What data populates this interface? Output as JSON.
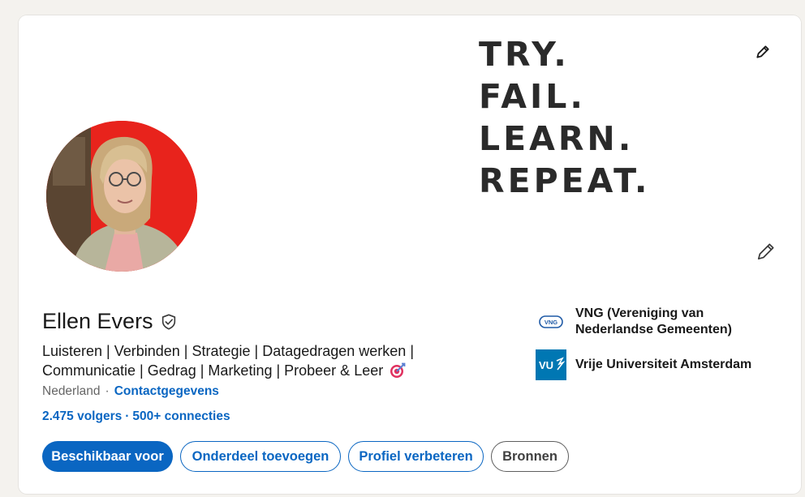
{
  "banner": {
    "lines": [
      "TRY.",
      "FAIL.",
      "LEARN.",
      "REPEAT."
    ]
  },
  "profile": {
    "name": "Ellen Evers",
    "headline_line1": "Luisteren | Verbinden | Strategie | Datagedragen werken |",
    "headline_line2": "Communicatie | Gedrag | Marketing | Probeer & Leer",
    "location": "Nederland",
    "location_separator": "·",
    "contact_label": "Contactgegevens",
    "followers": "2.475 volgers",
    "stats_separator": "·",
    "connections": "500+ connecties"
  },
  "actions": {
    "available": "Beschikbaar voor",
    "add_section": "Onderdeel toevoegen",
    "improve_profile": "Profiel verbeteren",
    "resources": "Bronnen"
  },
  "organizations": [
    {
      "name_line1": "VNG (Vereniging van",
      "name_line2": "Nederlandse Gemeenten)",
      "logo_text": "VNG"
    },
    {
      "name_line1": "Vrije Universiteit Amsterdam",
      "name_line2": "",
      "logo_text": "VU"
    }
  ],
  "icons": {
    "edit_banner": "pencil-icon",
    "edit_profile": "pencil-icon",
    "verified": "shield-check-icon",
    "headline_emoji": "target-icon"
  },
  "colors": {
    "accent": "#0a66c2",
    "vu_blue": "#0077b3",
    "avatar_bg": "#e8231c"
  }
}
